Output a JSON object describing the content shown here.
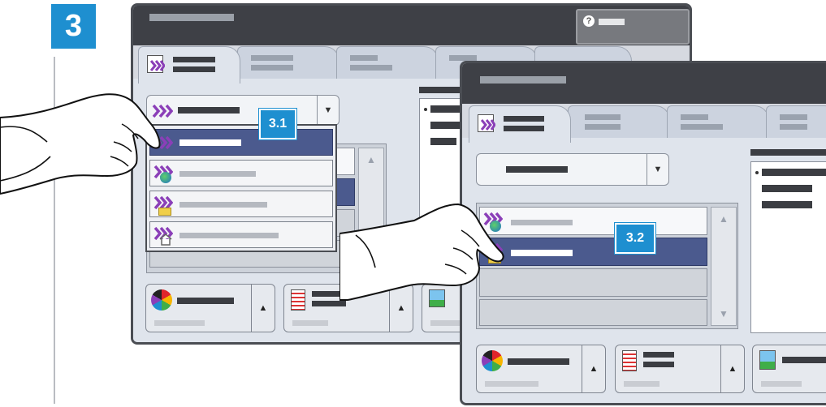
{
  "step": {
    "number": "3"
  },
  "callouts": {
    "first": "3.1",
    "second": "3.2"
  },
  "icons": {
    "badge_color": "#1e8fd0",
    "selected_row_color": "#4b5a8e",
    "chevron_color": "#8b3fb8",
    "help": "help-question-icon",
    "scan": "scan-chevron-icon",
    "globe": "globe-icon",
    "folder": "folder-icon",
    "home": "home-icon",
    "color": "color-wheel-icon",
    "document": "document-lines-icon",
    "image": "image-icon",
    "hand": "pointing-hand-icon"
  }
}
